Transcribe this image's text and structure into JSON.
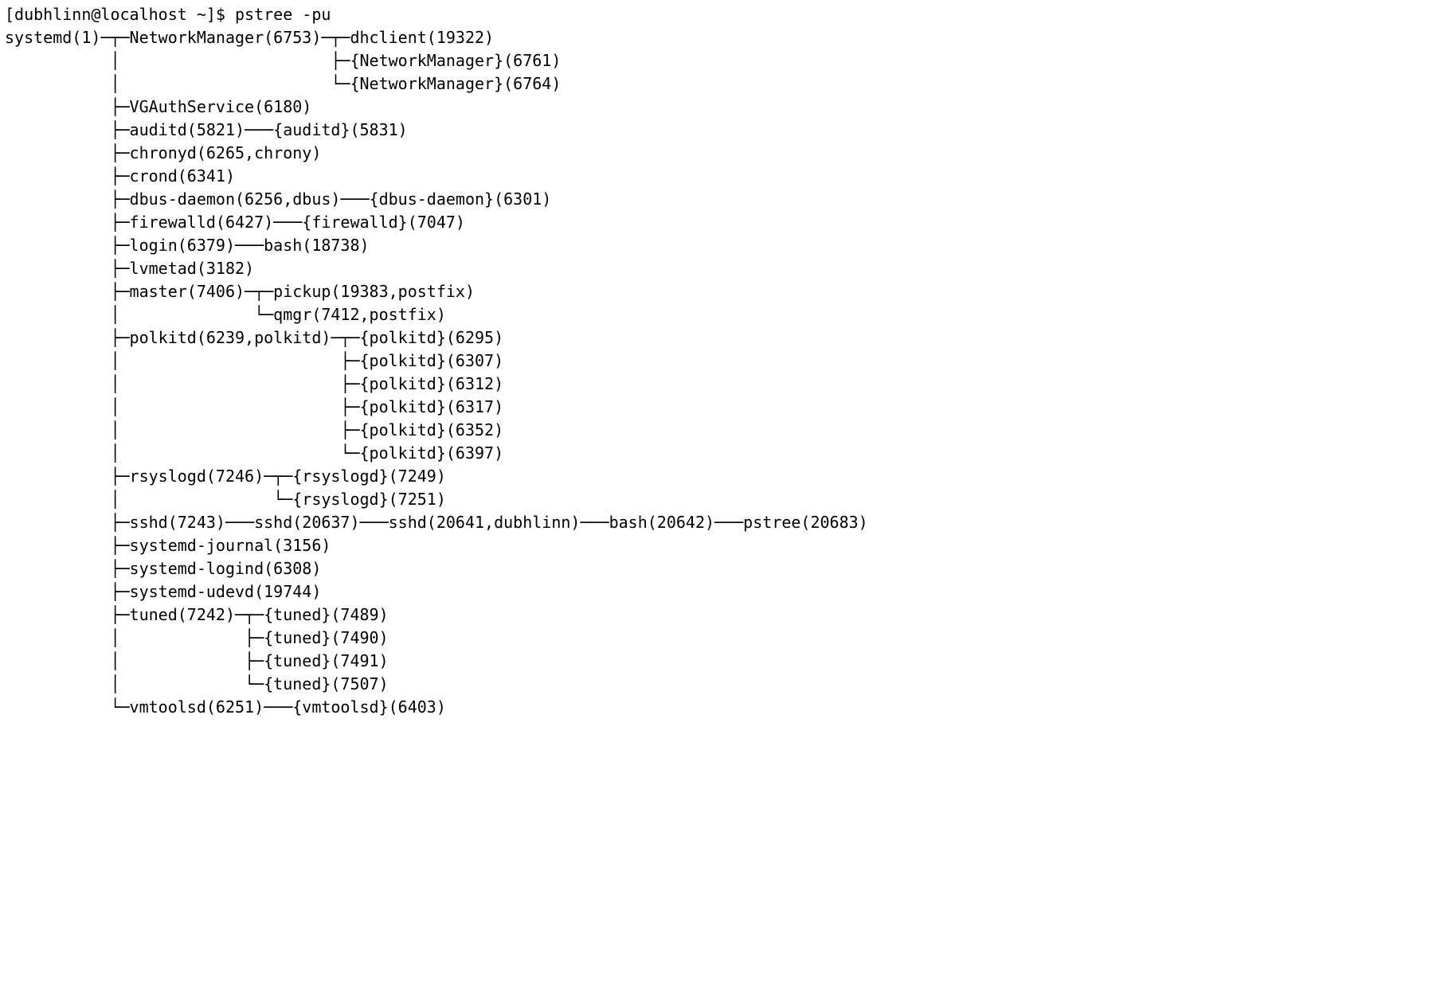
{
  "prompt": "[dubhlinn@localhost ~]$ ",
  "command": "pstree -pu",
  "lines": [
    "systemd(1)─┬─NetworkManager(6753)─┬─dhclient(19322)",
    "           │                      ├─{NetworkManager}(6761)",
    "           │                      └─{NetworkManager}(6764)",
    "           ├─VGAuthService(6180)",
    "           ├─auditd(5821)───{auditd}(5831)",
    "           ├─chronyd(6265,chrony)",
    "           ├─crond(6341)",
    "           ├─dbus-daemon(6256,dbus)───{dbus-daemon}(6301)",
    "           ├─firewalld(6427)───{firewalld}(7047)",
    "           ├─login(6379)───bash(18738)",
    "           ├─lvmetad(3182)",
    "           ├─master(7406)─┬─pickup(19383,postfix)",
    "           │              └─qmgr(7412,postfix)",
    "           ├─polkitd(6239,polkitd)─┬─{polkitd}(6295)",
    "           │                       ├─{polkitd}(6307)",
    "           │                       ├─{polkitd}(6312)",
    "           │                       ├─{polkitd}(6317)",
    "           │                       ├─{polkitd}(6352)",
    "           │                       └─{polkitd}(6397)",
    "           ├─rsyslogd(7246)─┬─{rsyslogd}(7249)",
    "           │                └─{rsyslogd}(7251)",
    "           ├─sshd(7243)───sshd(20637)───sshd(20641,dubhlinn)───bash(20642)───pstree(20683)",
    "           ├─systemd-journal(3156)",
    "           ├─systemd-logind(6308)",
    "           ├─systemd-udevd(19744)",
    "           ├─tuned(7242)─┬─{tuned}(7489)",
    "           │             ├─{tuned}(7490)",
    "           │             ├─{tuned}(7491)",
    "           │             └─{tuned}(7507)",
    "           └─vmtoolsd(6251)───{vmtoolsd}(6403)"
  ]
}
